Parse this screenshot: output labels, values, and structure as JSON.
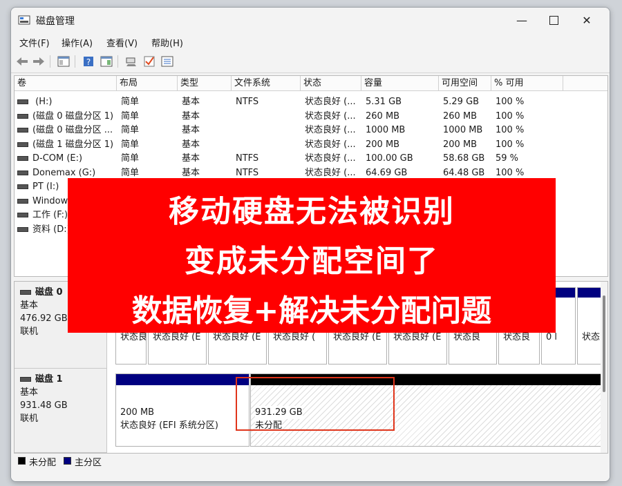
{
  "window": {
    "title": "磁盘管理"
  },
  "menu": [
    {
      "label": "文件(F)"
    },
    {
      "label": "操作(A)"
    },
    {
      "label": "查看(V)"
    },
    {
      "label": "帮助(H)"
    }
  ],
  "toolbar": {
    "buttons": [
      "back-icon",
      "forward-icon",
      "properties-icon",
      "help-icon",
      "console-icon",
      "connect-icon",
      "check-icon",
      "list-icon"
    ]
  },
  "columns": [
    "卷",
    "布局",
    "类型",
    "文件系统",
    "状态",
    "容量",
    "可用空间",
    "% 可用"
  ],
  "volumes": [
    {
      "name": " (H:)",
      "layout": "简单",
      "type": "基本",
      "fs": "NTFS",
      "status": "状态良好 (...",
      "capacity": "5.31 GB",
      "free": "5.29 GB",
      "pct": "100 %"
    },
    {
      "name": "(磁盘 0 磁盘分区 1)",
      "layout": "简单",
      "type": "基本",
      "fs": "",
      "status": "状态良好 (...",
      "capacity": "260 MB",
      "free": "260 MB",
      "pct": "100 %"
    },
    {
      "name": "(磁盘 0 磁盘分区 ...",
      "layout": "简单",
      "type": "基本",
      "fs": "",
      "status": "状态良好 (...",
      "capacity": "1000 MB",
      "free": "1000 MB",
      "pct": "100 %"
    },
    {
      "name": "(磁盘 1 磁盘分区 1)",
      "layout": "简单",
      "type": "基本",
      "fs": "",
      "status": "状态良好 (...",
      "capacity": "200 MB",
      "free": "200 MB",
      "pct": "100 %"
    },
    {
      "name": "D-COM (E:)",
      "layout": "简单",
      "type": "基本",
      "fs": "NTFS",
      "status": "状态良好 (...",
      "capacity": "100.00 GB",
      "free": "58.68 GB",
      "pct": "59 %"
    },
    {
      "name": "Donemax (G:)",
      "layout": "简单",
      "type": "基本",
      "fs": "NTFS",
      "status": "状态良好 (...",
      "capacity": "64.69 GB",
      "free": "64.48 GB",
      "pct": "100 %"
    },
    {
      "name": "PT (I:)",
      "layout": "",
      "type": "",
      "fs": "",
      "status": "",
      "capacity": "",
      "free": "",
      "pct": ""
    },
    {
      "name": "Windows",
      "layout": "",
      "type": "",
      "fs": "",
      "status": "",
      "capacity": "",
      "free": "",
      "pct": ""
    },
    {
      "name": "工作 (F:)",
      "layout": "",
      "type": "",
      "fs": "",
      "status": "",
      "capacity": "",
      "free": "",
      "pct": ""
    },
    {
      "name": "资料 (D:)",
      "layout": "",
      "type": "",
      "fs": "",
      "status": "",
      "capacity": "",
      "free": "",
      "pct": ""
    }
  ],
  "disks": [
    {
      "name": "磁盘 0",
      "kind": "基本",
      "size": "476.92 GB",
      "state": "联机",
      "partial_parts": [
        "状态良",
        "状态良好 (E",
        "状态良好 (E",
        "状态良好 (",
        "状态良好 (E",
        "状态良好 (E",
        "状态良",
        "状态良",
        "0 l",
        "状态良"
      ]
    },
    {
      "name": "磁盘 1",
      "kind": "基本",
      "size": "931.48 GB",
      "state": "联机",
      "partitions": [
        {
          "size": "200 MB",
          "status": "状态良好 (EFI 系统分区)"
        },
        {
          "size": "931.29 GB",
          "status": "未分配"
        }
      ]
    }
  ],
  "legend": [
    {
      "label": "未分配",
      "color": "#000000"
    },
    {
      "label": "主分区",
      "color": "#000080"
    }
  ],
  "banner": {
    "lines": [
      "移动硬盘无法被识别",
      "变成未分配空间了",
      "数据恢复+解决未分配问题"
    ]
  },
  "colors": {
    "primary_partition": "#000080",
    "unallocated": "#000000",
    "banner_bg": "#ff0000",
    "highlight": "#e0341a"
  }
}
